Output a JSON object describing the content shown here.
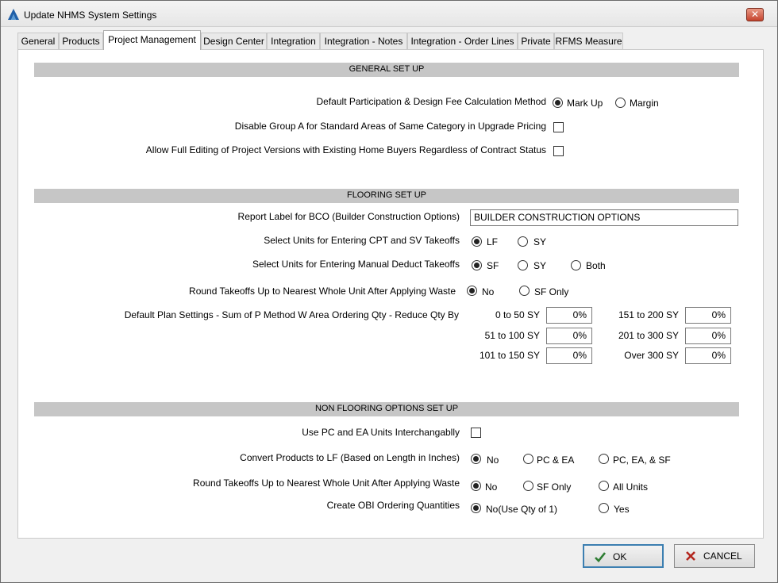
{
  "window": {
    "title": "Update NHMS System Settings",
    "close_label": "✕"
  },
  "tabs": [
    {
      "label": "General"
    },
    {
      "label": "Products"
    },
    {
      "label": "Project Management"
    },
    {
      "label": "Design Center"
    },
    {
      "label": "Integration"
    },
    {
      "label": "Integration - Notes"
    },
    {
      "label": "Integration - Order Lines"
    },
    {
      "label": "Private"
    },
    {
      "label": "RFMS Measure"
    }
  ],
  "general": {
    "header": "GENERAL SET UP",
    "fee_method_label": "Default Participation & Design Fee Calculation Method",
    "fee_markup": "Mark Up",
    "fee_margin": "Margin",
    "disable_group_label": "Disable Group A for Standard Areas of Same Category in Upgrade Pricing",
    "full_edit_label": "Allow Full Editing of Project Versions with Existing Home Buyers Regardless of Contract Status"
  },
  "flooring": {
    "header": "FLOORING SET UP",
    "bco_label": "Report Label for BCO (Builder Construction Options)",
    "bco_value": "BUILDER CONSTRUCTION OPTIONS",
    "cpt_label": "Select Units for Entering CPT and SV Takeoffs",
    "cpt_lf": "LF",
    "cpt_sy": "SY",
    "deduct_label": "Select Units for Entering Manual Deduct Takeoffs",
    "deduct_sf": "SF",
    "deduct_sy": "SY",
    "deduct_both": "Both",
    "round_label": "Round Takeoffs Up to Nearest Whole Unit After Applying Waste",
    "round_no": "No",
    "round_sf": "SF Only",
    "plan_label": "Default Plan Settings - Sum of P Method W Area Ordering Qty -  Reduce Qty By",
    "ranges": [
      {
        "label": "0 to 50 SY",
        "value": "0%"
      },
      {
        "label": "51 to 100 SY",
        "value": "0%"
      },
      {
        "label": "101 to 150 SY",
        "value": "0%"
      },
      {
        "label": "151 to 200 SY",
        "value": "0%"
      },
      {
        "label": "201 to 300 SY",
        "value": "0%"
      },
      {
        "label": "Over 300 SY",
        "value": "0%"
      }
    ]
  },
  "nonflooring": {
    "header": "NON FLOORING OPTIONS SET UP",
    "pc_ea_label": "Use PC and EA Units Interchangablly",
    "convert_label": "Convert Products to LF (Based on Length in Inches)",
    "convert_no": "No",
    "convert_pc_ea": "PC & EA",
    "convert_pc_ea_sf": "PC, EA, & SF",
    "round_label": "Round Takeoffs Up to Nearest Whole Unit After Applying Waste",
    "round_no": "No",
    "round_sf": "SF Only",
    "round_all": "All Units",
    "obi_label": "Create OBI Ordering Quantities",
    "obi_no": "No(Use Qty of 1)",
    "obi_yes": "Yes"
  },
  "buttons": {
    "ok": "OK",
    "cancel": "CANCEL"
  },
  "colors": {
    "section_bar": "#c6c6c6",
    "ok_check": "#2e7d32",
    "cancel_x": "#b3261e",
    "app_icon": "#1f5fa8"
  }
}
